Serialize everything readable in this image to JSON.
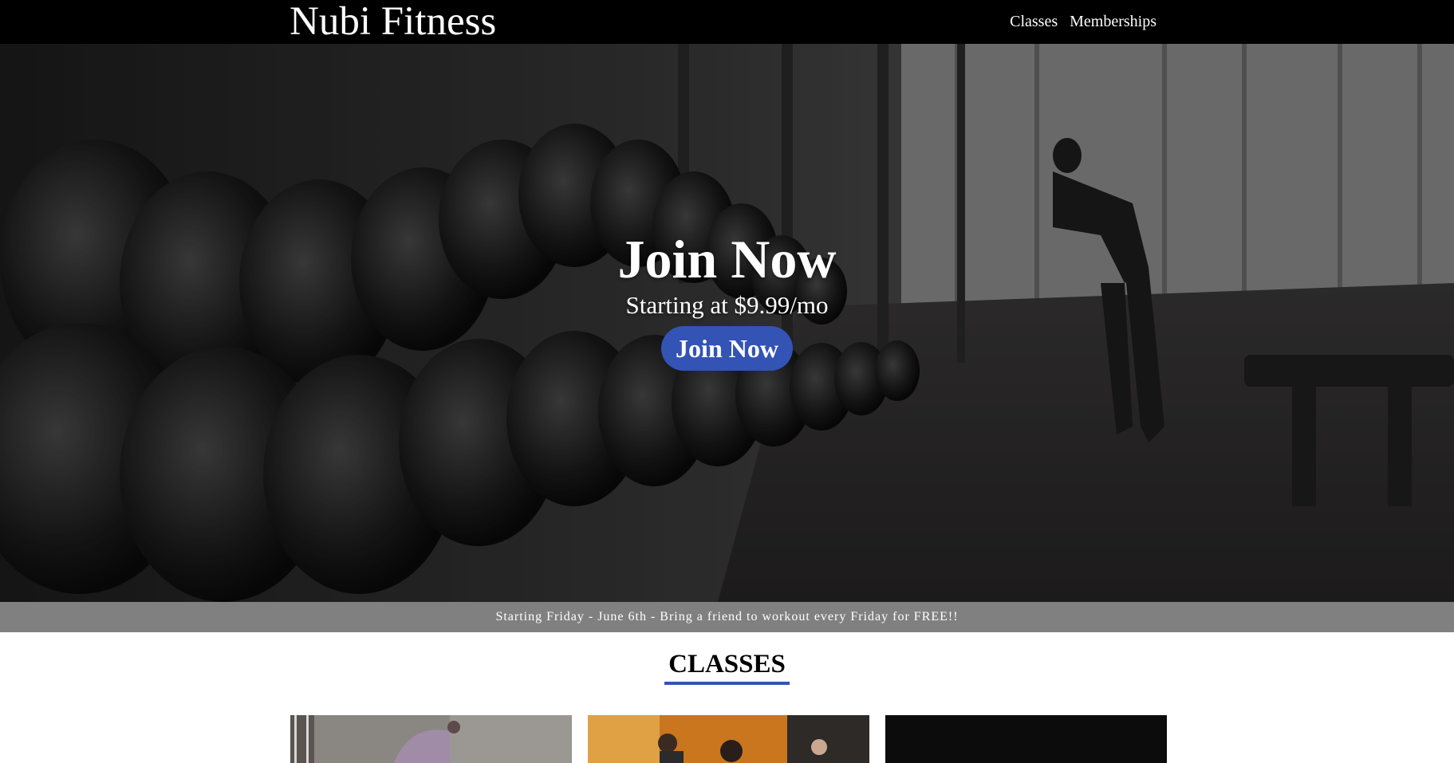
{
  "nav": {
    "brand": "Nubi Fitness",
    "links": [
      {
        "label": "Classes"
      },
      {
        "label": "Memberships"
      }
    ]
  },
  "hero": {
    "title": "Join Now",
    "subtitle": "Starting at $9.99/mo",
    "button_label": "Join Now"
  },
  "promo": {
    "text": "Starting Friday - June 6th - Bring a friend to workout every Friday for FREE!!"
  },
  "classes": {
    "heading": "CLASSES"
  },
  "colors": {
    "accent": "#3353b5",
    "navbar": "#000000",
    "promo_bar": "#808080"
  }
}
